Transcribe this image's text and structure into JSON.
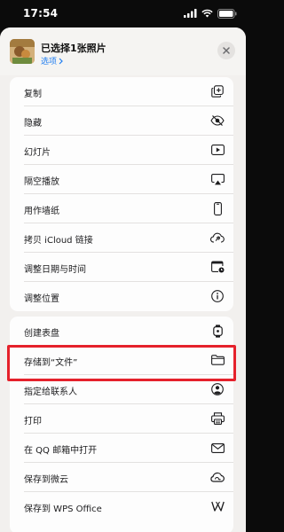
{
  "status": {
    "time": "17:54"
  },
  "header": {
    "title": "已选择1张照片",
    "subtitle": "选项"
  },
  "group1": [
    {
      "label": "复制",
      "icon": "duplicate-icon"
    },
    {
      "label": "隐藏",
      "icon": "eye-slash-icon"
    },
    {
      "label": "幻灯片",
      "icon": "play-rectangle-icon"
    },
    {
      "label": "隔空播放",
      "icon": "airplay-icon"
    },
    {
      "label": "用作墙纸",
      "icon": "iphone-icon"
    },
    {
      "label": "拷贝 iCloud 链接",
      "icon": "cloud-link-icon"
    },
    {
      "label": "调整日期与时间",
      "icon": "calendar-clock-icon"
    },
    {
      "label": "调整位置",
      "icon": "location-info-icon"
    }
  ],
  "group2": [
    {
      "label": "创建表盘",
      "icon": "watch-icon"
    },
    {
      "label": "存储到“文件”",
      "icon": "folder-icon"
    },
    {
      "label": "指定给联系人",
      "icon": "person-circle-icon"
    },
    {
      "label": "打印",
      "icon": "printer-icon"
    },
    {
      "label": "在 QQ 邮箱中打开",
      "icon": "envelope-icon"
    },
    {
      "label": "保存到微云",
      "icon": "weiyun-icon"
    },
    {
      "label": "保存到 WPS Office",
      "icon": "wps-icon"
    }
  ],
  "colors": {
    "highlight": "#e5212b",
    "link": "#1e7cf0"
  }
}
